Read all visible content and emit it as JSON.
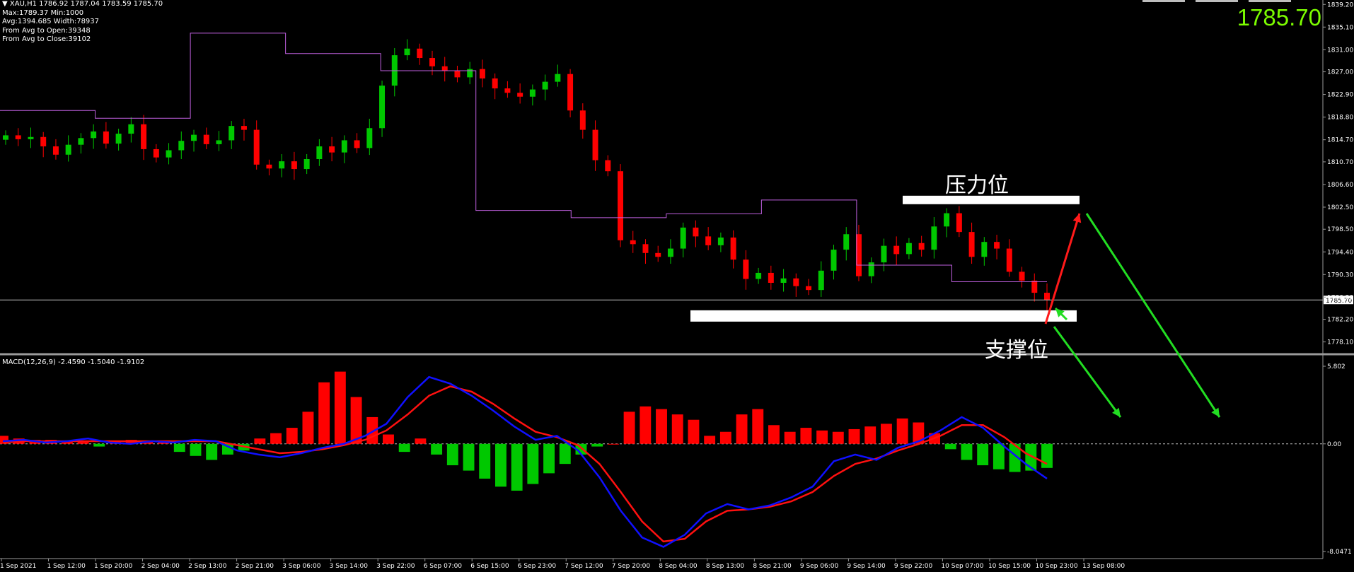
{
  "header": {
    "symbol": "XAU,H1",
    "ohlc": "1786.92 1787.04 1783.59 1785.70",
    "line2": "Max:1789.37 Min:1000",
    "line3": "Avg:1394.685 Width:78937",
    "line4": "From Avg to Open:39348",
    "line5": "From Avg to Close:39102",
    "current_price": "1785.70"
  },
  "annotations": {
    "resistance": "压力位",
    "support": "支撑位"
  },
  "macd": {
    "label": "MACD(12,26,9) -2.4590 -1.5040 -1.9102",
    "scale_labels": [
      "5.802",
      "0.00",
      "-8.0471"
    ]
  },
  "colors": {
    "bull": "#00c800",
    "bear": "#ff0000",
    "level_line": "#c060e0",
    "macd_line": "#1010ff",
    "signal_line": "#ff1010",
    "background": "#000000"
  },
  "chart_data": [
    {
      "type": "candlestick",
      "title": "XAU,H1",
      "ylim": [
        1776.0,
        1840.0
      ],
      "y_ticks": [
        "1839.20",
        "1835.10",
        "1831.00",
        "1827.00",
        "1822.90",
        "1818.80",
        "1814.70",
        "1810.70",
        "1806.60",
        "1802.50",
        "1798.50",
        "1794.40",
        "1790.30",
        "1786.20",
        "1782.20",
        "1778.10"
      ],
      "current_price": 1785.7,
      "x_labels": [
        "1 Sep 2021",
        "1 Sep 12:00",
        "1 Sep 20:00",
        "2 Sep 04:00",
        "2 Sep 13:00",
        "2 Sep 21:00",
        "3 Sep 06:00",
        "3 Sep 14:00",
        "3 Sep 22:00",
        "6 Sep 07:00",
        "6 Sep 15:00",
        "6 Sep 23:00",
        "7 Sep 12:00",
        "7 Sep 20:00",
        "8 Sep 04:00",
        "8 Sep 13:00",
        "8 Sep 21:00",
        "9 Sep 06:00",
        "9 Sep 14:00",
        "9 Sep 22:00",
        "10 Sep 07:00",
        "10 Sep 15:00",
        "10 Sep 23:00",
        "13 Sep 08:00"
      ],
      "close_series": [
        1815.5,
        1814.8,
        1815.2,
        1813.5,
        1812.0,
        1813.8,
        1815.0,
        1816.2,
        1814.0,
        1815.8,
        1817.5,
        1813.0,
        1811.5,
        1812.8,
        1814.5,
        1815.6,
        1813.9,
        1814.6,
        1817.2,
        1816.5,
        1810.2,
        1809.5,
        1810.8,
        1809.4,
        1811.2,
        1813.5,
        1812.4,
        1814.6,
        1813.2,
        1816.8,
        1824.5,
        1830.0,
        1831.2,
        1829.5,
        1828.0,
        1827.2,
        1826.0,
        1827.5,
        1825.8,
        1824.0,
        1823.2,
        1822.5,
        1823.8,
        1825.2,
        1826.6,
        1820.0,
        1816.5,
        1811.0,
        1809.0,
        1796.5,
        1795.8,
        1794.2,
        1793.5,
        1795.0,
        1798.8,
        1797.2,
        1795.6,
        1797.0,
        1793.0,
        1789.5,
        1790.6,
        1788.8,
        1789.6,
        1788.2,
        1787.5,
        1791.0,
        1794.8,
        1797.6,
        1790.0,
        1792.5,
        1795.5,
        1794.0,
        1796.0,
        1794.8,
        1799.0,
        1801.4,
        1798.0,
        1793.5,
        1796.2,
        1795.0,
        1790.8,
        1789.2,
        1787.0,
        1785.7
      ],
      "levels": [
        1820.0,
        1818.6,
        1834.0,
        1830.3,
        1827.2,
        1801.9,
        1800.6,
        1801.3,
        1803.8,
        1792.0,
        1789.0
      ],
      "resistance_band": 1803.8,
      "support_band": 1782.8
    },
    {
      "type": "line",
      "title": "MACD(12,26,9)",
      "ylim": [
        -8.0471,
        5.802
      ],
      "series": [
        {
          "name": "MACD",
          "values": [
            0.2,
            0.3,
            0.1,
            0.2,
            0.4,
            0.1,
            0.0,
            0.2,
            0.1,
            0.3,
            0.2,
            -0.5,
            -0.8,
            -1.0,
            -0.7,
            -0.3,
            0.0,
            0.6,
            1.5,
            3.5,
            5.0,
            4.5,
            3.6,
            2.5,
            1.3,
            0.3,
            0.6,
            -0.5,
            -2.5,
            -5.0,
            -7.0,
            -7.7,
            -6.8,
            -5.2,
            -4.5,
            -4.9,
            -4.6,
            -4.0,
            -3.2,
            -1.3,
            -0.8,
            -1.2,
            -0.3,
            0.2,
            1.0,
            2.0,
            1.2,
            -0.2,
            -1.5,
            -2.6
          ]
        },
        {
          "name": "Signal",
          "values": [
            0.1,
            0.2,
            0.2,
            0.2,
            0.2,
            0.2,
            0.2,
            0.2,
            0.2,
            0.2,
            0.2,
            -0.1,
            -0.4,
            -0.7,
            -0.6,
            -0.4,
            -0.1,
            0.3,
            1.0,
            2.2,
            3.6,
            4.3,
            3.9,
            3.0,
            1.9,
            0.9,
            0.5,
            -0.1,
            -1.5,
            -3.6,
            -5.8,
            -7.3,
            -7.1,
            -5.8,
            -5.0,
            -4.9,
            -4.7,
            -4.3,
            -3.6,
            -2.4,
            -1.5,
            -1.1,
            -0.5,
            0.0,
            0.6,
            1.4,
            1.4,
            0.5,
            -0.7,
            -1.5
          ]
        }
      ],
      "histogram": [
        0.6,
        0.4,
        0.3,
        0.3,
        0.2,
        0.2,
        -0.2,
        0.2,
        0.3,
        0.2,
        0.2,
        -0.6,
        -0.9,
        -1.2,
        -0.8,
        -0.5,
        0.4,
        0.8,
        1.2,
        2.4,
        4.6,
        5.4,
        3.5,
        2.0,
        0.7,
        -0.6,
        0.4,
        -0.8,
        -1.6,
        -2.0,
        -2.6,
        -3.2,
        -3.5,
        -3.0,
        -2.2,
        -1.5,
        -0.8,
        -0.2,
        0.0,
        2.4,
        2.8,
        2.6,
        2.2,
        1.8,
        0.6,
        0.9,
        2.2,
        2.6,
        1.4,
        0.9,
        1.2,
        1.0,
        0.9,
        1.1,
        1.3,
        1.5,
        1.9,
        1.6,
        0.8,
        -0.4,
        -1.2,
        -1.6,
        -1.9,
        -2.1,
        -2.0,
        -1.8
      ]
    }
  ]
}
